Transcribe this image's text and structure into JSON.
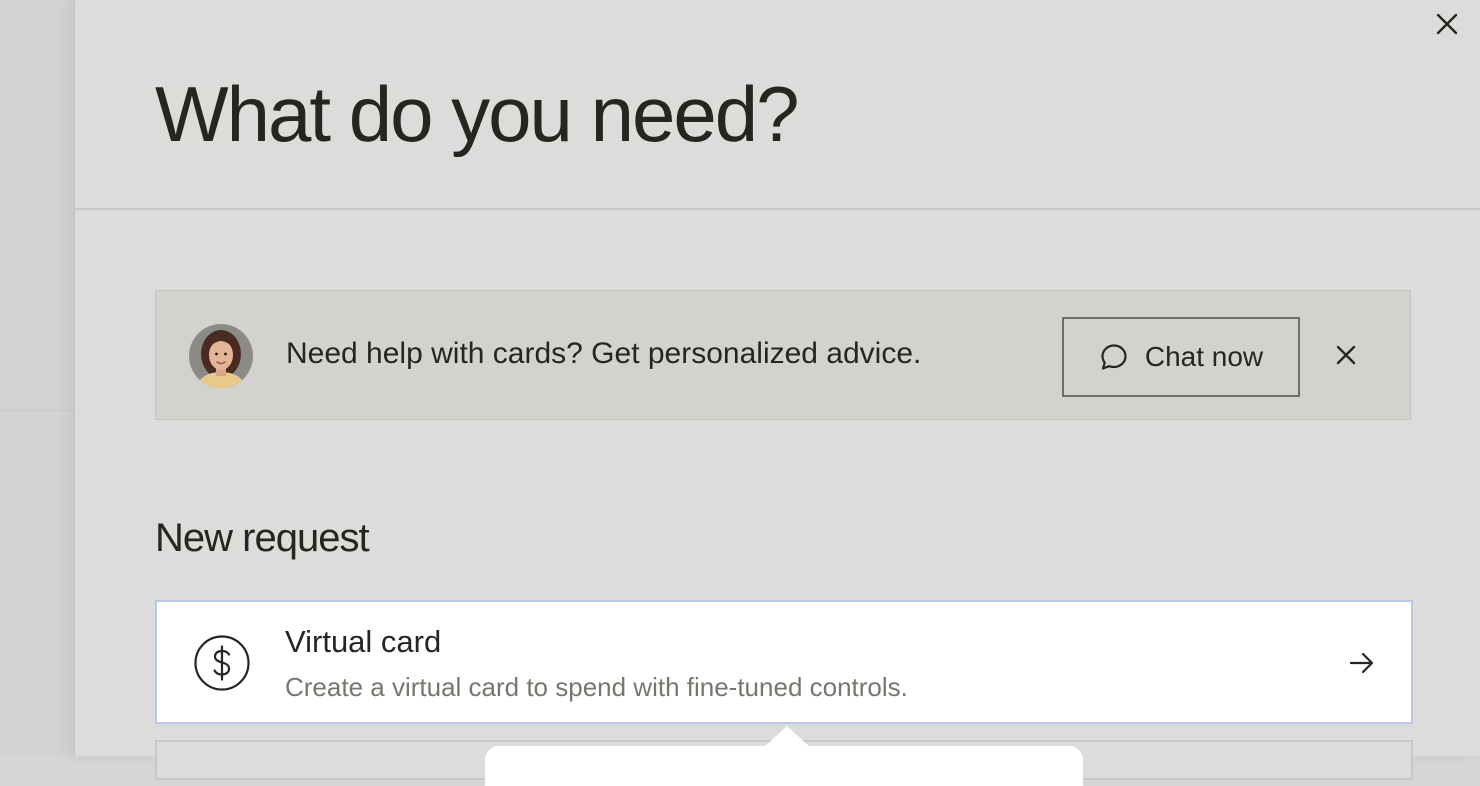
{
  "dialog": {
    "title": "What do you need?",
    "close_icon": "close-icon"
  },
  "banner": {
    "avatar": "advisor-avatar",
    "message": "Need help with cards? Get personalized advice.",
    "chat_button_label": "Chat now",
    "chat_icon": "chat-bubble-icon",
    "dismiss_icon": "close-icon"
  },
  "new_request": {
    "heading": "New request",
    "options": [
      {
        "title": "Virtual card",
        "description": "Create a virtual card to spend with fine-tuned controls.",
        "icon": "dollar-circle-icon",
        "arrow_icon": "arrow-right-icon"
      }
    ]
  },
  "colors": {
    "text_primary": "#262621",
    "text_secondary": "#77766f",
    "panel_bg": "#dcdcdb",
    "banner_bg": "#d3d2cf",
    "card_focus_border": "#b9c9e7"
  }
}
